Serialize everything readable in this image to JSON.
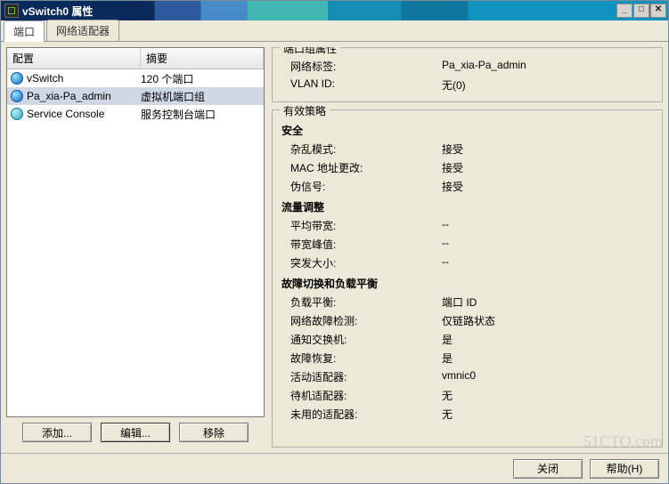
{
  "window": {
    "title": "vSwitch0 属性"
  },
  "winbtns": {
    "min": "_",
    "max": "□",
    "close": "✕"
  },
  "tabs": {
    "ports": "端口",
    "adapters": "网络适配器"
  },
  "grid": {
    "head_config": "配置",
    "head_summary": "摘要",
    "rows": [
      {
        "icon": "net-icon",
        "config": "vSwitch",
        "summary": "120 个端口"
      },
      {
        "icon": "net-icon",
        "config": "Pa_xia-Pa_admin",
        "summary": "虚拟机端口组"
      },
      {
        "icon": "srv-icon",
        "config": "Service Console",
        "summary": "服务控制台端口"
      }
    ]
  },
  "left_buttons": {
    "add": "添加...",
    "edit": "编辑...",
    "remove": "移除"
  },
  "pg_props": {
    "legend": "端口组属性",
    "net_label_k": "网络标签:",
    "net_label_v": "Pa_xia-Pa_admin",
    "vlan_k": "VLAN ID:",
    "vlan_v": "无(0)"
  },
  "policy": {
    "legend": "有效策略",
    "security_h": "安全",
    "promisc_k": "杂乱模式:",
    "promisc_v": "接受",
    "mac_k": "MAC 地址更改:",
    "mac_v": "接受",
    "forged_k": "伪信号:",
    "forged_v": "接受",
    "shaping_h": "流量调整",
    "avg_k": "平均带宽:",
    "avg_v": "--",
    "peak_k": "带宽峰值:",
    "peak_v": "--",
    "burst_k": "突发大小:",
    "burst_v": "--",
    "failover_h": "故障切换和负载平衡",
    "lb_k": "负载平衡:",
    "lb_v": "端口 ID",
    "nfd_k": "网络故障检测:",
    "nfd_v": "仅链路状态",
    "notify_k": "通知交换机:",
    "notify_v": "是",
    "failback_k": "故障恢复:",
    "failback_v": "是",
    "active_k": "活动适配器:",
    "active_v": "vmnic0",
    "standby_k": "待机适配器:",
    "standby_v": "无",
    "unused_k": "未用的适配器:",
    "unused_v": "无"
  },
  "footer": {
    "close": "关闭",
    "help": "帮助(H)"
  },
  "watermark": "51CTO.com"
}
